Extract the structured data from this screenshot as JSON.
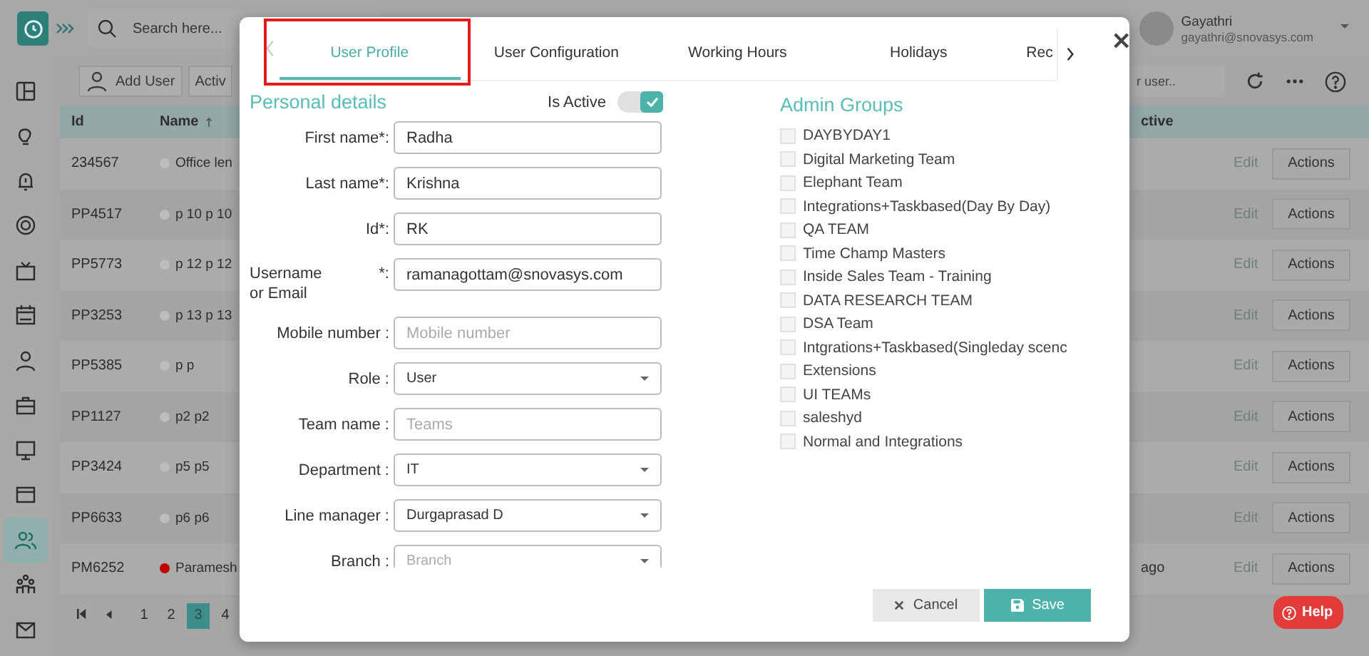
{
  "app": {
    "search_placeholder": "Search here...",
    "user": {
      "name": "Gayathri",
      "email": "gayathri@snovasys.com"
    },
    "sidebar": [
      {
        "selected": false
      },
      {
        "selected": false
      },
      {
        "selected": false
      },
      {
        "selected": false
      },
      {
        "selected": false
      },
      {
        "selected": false
      },
      {
        "selected": false
      },
      {
        "selected": false
      },
      {
        "selected": false
      },
      {
        "selected": false
      },
      {
        "selected": true
      },
      {
        "selected": false
      },
      {
        "selected": false
      }
    ],
    "toolbar": {
      "add_button": "Add User",
      "filter_button": "Activ",
      "search_placeholder": "r user.."
    },
    "table": {
      "columns": [
        "Id",
        "Name",
        "ctive"
      ],
      "rows": [
        {
          "id": "234567",
          "name": "Office len",
          "color": "#bdbdbd",
          "active": "",
          "edit": "Edit",
          "action": "Actions"
        },
        {
          "id": "PP4517",
          "name": "p 10 p 10",
          "color": "#bdbdbd",
          "edit": "Edit",
          "action": "Actions"
        },
        {
          "id": "PP5773",
          "name": "p 12 p 12",
          "color": "#bdbdbd",
          "edit": "Edit",
          "action": "Actions"
        },
        {
          "id": "PP3253",
          "name": "p 13 p 13",
          "color": "#bdbdbd",
          "edit": "Edit",
          "action": "Actions"
        },
        {
          "id": "PP5385",
          "name": "p p",
          "color": "#bdbdbd",
          "edit": "Edit",
          "action": "Actions"
        },
        {
          "id": "PP1127",
          "name": "p2 p2",
          "color": "#bdbdbd",
          "edit": "Edit",
          "action": "Actions"
        },
        {
          "id": "PP3424",
          "name": "p5 p5",
          "color": "#bdbdbd",
          "edit": "Edit",
          "action": "Actions"
        },
        {
          "id": "PP6633",
          "name": "p6 p6",
          "color": "#bdbdbd",
          "edit": "Edit",
          "action": "Actions"
        },
        {
          "id": "PM6252",
          "name": "Paramesh",
          "color": "#c00000",
          "active": "ago",
          "edit": "Edit",
          "action": "Actions"
        }
      ]
    },
    "pagination": [
      {
        "label": "1",
        "selected": false
      },
      {
        "label": "2",
        "selected": false
      },
      {
        "label": "3",
        "selected": true
      },
      {
        "label": "4",
        "selected": false
      }
    ]
  },
  "modal": {
    "tabs": [
      {
        "label": "User Profile",
        "selected": true
      },
      {
        "label": "User Configuration",
        "selected": false
      },
      {
        "label": "Working Hours",
        "selected": false
      },
      {
        "label": "Holidays",
        "selected": false
      },
      {
        "label": "Rec",
        "selected": false
      }
    ],
    "personal": {
      "heading": "Personal details",
      "active_label": "Is Active",
      "active": true,
      "fields": [
        {
          "kind": "text",
          "label": "First name*:",
          "value": "Radha"
        },
        {
          "kind": "text",
          "label": "Last name*:",
          "value": "Krishna"
        },
        {
          "kind": "text",
          "label": "Id*:",
          "value": "RK"
        },
        {
          "kind": "text",
          "label": "Username or Email",
          "suffix": "*:",
          "value": "ramanagottam@snovasys.com"
        },
        {
          "kind": "text",
          "label": "Mobile number :",
          "placeholder": "Mobile number"
        },
        {
          "kind": "select",
          "label": "Role :",
          "value": "User"
        },
        {
          "kind": "text",
          "label": "Team name :",
          "placeholder": "Teams"
        },
        {
          "kind": "select",
          "label": "Department :",
          "value": "IT"
        },
        {
          "kind": "select",
          "label": "Line manager :",
          "value": "Durgaprasad D"
        },
        {
          "kind": "select",
          "label": "Branch :",
          "placeholder": "Branch"
        }
      ]
    },
    "groups": {
      "heading": "Admin Groups",
      "items": [
        {
          "label": "DAYBYDAY1",
          "checked": false
        },
        {
          "label": "Digital Marketing Team",
          "checked": false
        },
        {
          "label": "Elephant Team",
          "checked": false
        },
        {
          "label": "Integrations+Taskbased(Day By Day)",
          "checked": false
        },
        {
          "label": "QA TEAM",
          "checked": false
        },
        {
          "label": "Time Champ Masters",
          "checked": false
        },
        {
          "label": "Inside Sales Team - Training",
          "checked": false
        },
        {
          "label": "DATA RESEARCH TEAM",
          "checked": false
        },
        {
          "label": "DSA Team",
          "checked": false
        },
        {
          "label": "Intgrations+Taskbased(Singleday scenc",
          "checked": false
        },
        {
          "label": "Extensions",
          "checked": false
        },
        {
          "label": "UI TEAMs",
          "checked": false
        },
        {
          "label": "saleshyd",
          "checked": false
        },
        {
          "label": "Normal and Integrations",
          "checked": false
        }
      ]
    },
    "cancel_button": "Cancel",
    "save_button": "Save"
  },
  "help_button": "Help"
}
